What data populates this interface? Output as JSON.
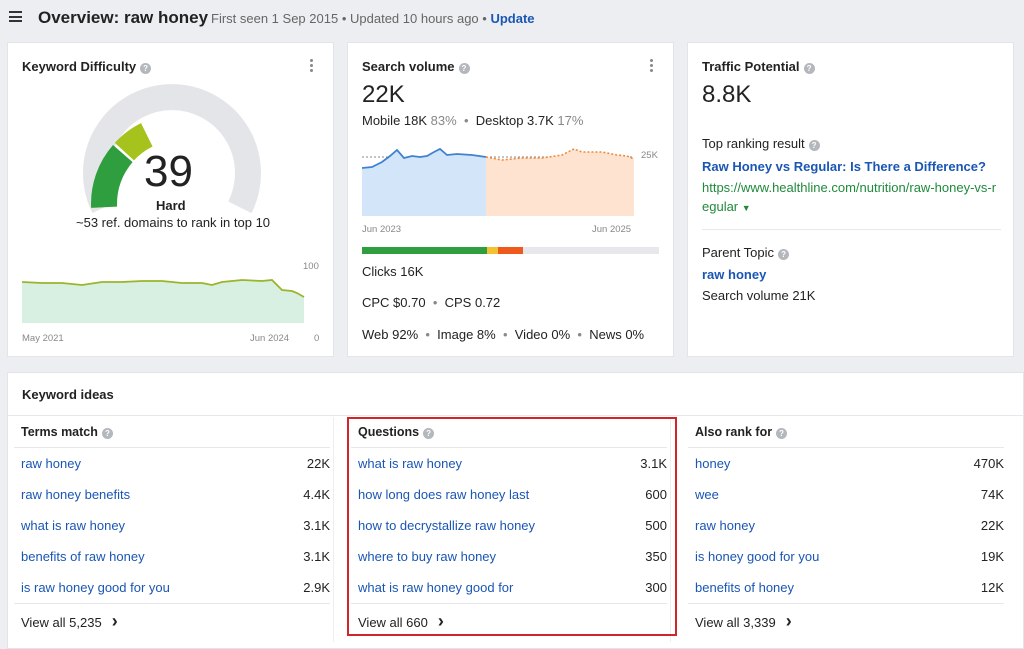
{
  "header": {
    "title": "Overview: raw honey",
    "first_seen": "First seen 1 Sep 2015",
    "updated": "Updated 10 hours ago",
    "update_label": "Update"
  },
  "kd": {
    "title": "Keyword Difficulty",
    "score": "39",
    "level": "Hard",
    "subtitle": "~53 ref. domains to rank in top 10",
    "y_top": "100",
    "y_bottom": "0",
    "x_start": "May 2021",
    "x_end": "Jun 2024"
  },
  "sv": {
    "title": "Search volume",
    "value": "22K",
    "mobile_label": "Mobile 18K",
    "mobile_pct": "83%",
    "desktop_label": "Desktop 3.7K",
    "desktop_pct": "17%",
    "y_tick": "25K",
    "x_start": "Jun 2023",
    "x_end": "Jun 2025",
    "clicks": "Clicks 16K",
    "cpc": "CPC $0.70",
    "cps": "CPS 0.72",
    "web": "Web 92%",
    "image": "Image 8%",
    "video": "Video 0%",
    "news": "News 0%"
  },
  "tp": {
    "title": "Traffic Potential",
    "value": "8.8K",
    "top_result_label": "Top ranking result",
    "top_result_title": "Raw Honey vs Regular: Is There a Difference?",
    "url_line1": "https://www.healthline.com/nutrition/raw-honey-vs-r",
    "url_line2": "egular",
    "parent_topic_label": "Parent Topic",
    "parent_topic": "raw honey",
    "parent_volume": "Search volume 21K"
  },
  "ideas": {
    "title": "Keyword ideas",
    "columns": [
      {
        "heading": "Terms match",
        "rows": [
          {
            "kw": "raw honey",
            "vol": "22K"
          },
          {
            "kw": "raw honey benefits",
            "vol": "4.4K"
          },
          {
            "kw": "what is raw honey",
            "vol": "3.1K"
          },
          {
            "kw": "benefits of raw honey",
            "vol": "3.1K"
          },
          {
            "kw": "is raw honey good for you",
            "vol": "2.9K"
          }
        ],
        "view_all": "View all 5,235"
      },
      {
        "heading": "Questions",
        "rows": [
          {
            "kw": "what is raw honey",
            "vol": "3.1K"
          },
          {
            "kw": "how long does raw honey last",
            "vol": "600"
          },
          {
            "kw": "how to decrystallize raw honey",
            "vol": "500"
          },
          {
            "kw": "where to buy raw honey",
            "vol": "350"
          },
          {
            "kw": "what is raw honey good for",
            "vol": "300"
          }
        ],
        "view_all": "View all 660"
      },
      {
        "heading": "Also rank for",
        "rows": [
          {
            "kw": "honey",
            "vol": "470K"
          },
          {
            "kw": "wee",
            "vol": "74K"
          },
          {
            "kw": "raw honey",
            "vol": "22K"
          },
          {
            "kw": "is honey good for you",
            "vol": "19K"
          },
          {
            "kw": "benefits of honey",
            "vol": "12K"
          }
        ],
        "view_all": "View all 3,339"
      }
    ]
  },
  "icons": {
    "menu": "hamburger-icon",
    "help": "question-mark-icon",
    "more": "vertical-dots-icon",
    "chevron": "chevron-right-icon",
    "caret": "caret-down-icon"
  },
  "colors": {
    "link": "#1a56b4",
    "url": "#1f8a3b",
    "gauge_green": "#2e9e3e",
    "gauge_lime": "#a6c21d",
    "highlight": "#d0262a"
  }
}
